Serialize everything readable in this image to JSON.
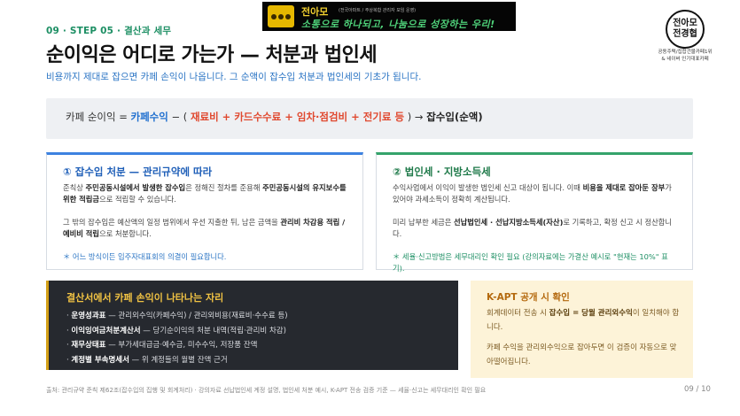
{
  "header": {
    "step": "09 · STEP 05 · 결산과 세무",
    "title": "순이익은 어디로 가는가 — 처분과 법인세",
    "subtitle": "비용까지 제대로 잡으면 카페 손익이 나옵니다. 그 순액이 잡수입 처분과 법인세의 기초가 됩니다."
  },
  "banner": {
    "name": "전아모",
    "small_text": "(전국아파트 / 주상복합 관리자 모임 운영)",
    "slogan": "소통으로 하나되고, 나눔으로 성장하는 우리!"
  },
  "logo": {
    "line1": "전아모",
    "line2": "전경협",
    "caption1": "공동주택/집합건물카페1위",
    "caption2": "& 네이버 인기대표카페"
  },
  "formula": {
    "prefix": "카페 순이익 = ",
    "income": "카페수익",
    "minus": " − ( ",
    "costs": "재료비 + 카드수수료 + 임차·점검비 + 전기료 등",
    "suffix": " ) → ",
    "result": "잡수입(순액)"
  },
  "card_left": {
    "title": "① 잡수입 처분 — 관리규약에 따라",
    "p1_a": "준칙상 ",
    "p1_b": "주민공동시설에서 발생한 잡수입",
    "p1_c": "은 정해진 절차를 준용해 ",
    "p1_d": "주민공동시설의 유지보수를 위한 적립금",
    "p1_e": "으로 적립할 수 있습니다.",
    "p2_a": "그 밖의 잡수입은 예산액의 일정 범위에서 우선 지출한 뒤, 남은 금액을 ",
    "p2_b": "관리비 차감용 적립 / 예비비 적립",
    "p2_c": "으로 처분합니다.",
    "note": "＊ 어느 방식이든 입주자대표회의 의결이 필요합니다."
  },
  "card_right": {
    "title": "② 법인세 · 지방소득세",
    "p1_a": "수익사업에서 이익이 발생한 법인세 신고 대상이 됩니다. 이때 ",
    "p1_b": "비용을 제대로 잡아둔 장부",
    "p1_c": "가 있어야 과세소득이 정확히 계산됩니다.",
    "p2_a": "미리 납부한 세금은 ",
    "p2_b": "선납법인세 · 선납지방소득세(자산)",
    "p2_c": "로 기록하고, 확정 신고 시 정산합니다.",
    "note": "＊ 세율·신고방법은 세무대리인 확인 필요 (강의자료에는 가결산 예시로 \"현재는 10%\" 표기)."
  },
  "dark_box": {
    "title": "결산서에서 카페 손익이 나타나는 자리",
    "items": [
      {
        "name": "운영성과표",
        "desc": " — 관리외수익(카페수익) / 관리외비용(재료비·수수료 등)"
      },
      {
        "name": "이익잉여금처분계산서",
        "desc": " — 당기순이익의 처분 내역(적립·관리비 차감)"
      },
      {
        "name": "재무상태표",
        "desc": " — 부가세대급금·예수금, 미수수익, 저장품 잔액"
      },
      {
        "name": "계정별 부속명세서",
        "desc": " — 위 계정들의 월별 잔액 근거"
      }
    ]
  },
  "kapt_box": {
    "title": "K-APT 공개 시 확인",
    "p1_a": "회계데이터 전송 시 ",
    "p1_b": "잡수입 = 당월 관리외수익",
    "p1_c": "이 일치해야 합니다.",
    "p2": "카페 수익을 관리외수익으로 잡아두면 이 검증이 자동으로 맞아떨어집니다."
  },
  "footer": {
    "source": "출처: 관리규약 준칙 제62조(잡수입의 집행 및 회계처리) · 강의자료 선납법인세 계정 설명, 법인세 처분 예시, K-APT 전송 검증 기준 — 세율·신고는 세무대리인 확인 필요",
    "page": "09 / 10"
  }
}
